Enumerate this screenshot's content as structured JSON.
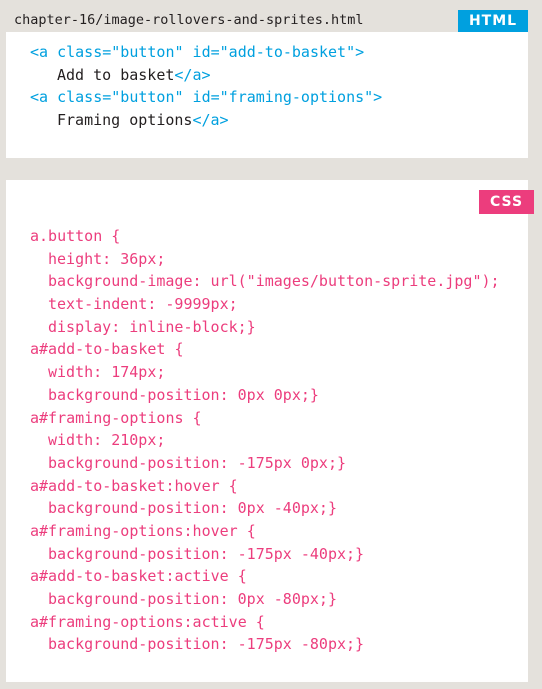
{
  "html_panel": {
    "filename": "chapter-16/image-rollovers-and-sprites.html",
    "tag": "HTML",
    "lines": [
      {
        "tag": "<a class=\"button\" id=\"add-to-basket\">"
      },
      {
        "text": "Add to basket",
        "close": "</a>"
      },
      {
        "tag": "<a class=\"button\" id=\"framing-options\">"
      },
      {
        "text": "Framing options",
        "close": "</a>"
      }
    ]
  },
  "css_panel": {
    "tag": "CSS",
    "lines": [
      "a.button {",
      "height: 36px;",
      "background-image: url(\"images/button-sprite.jpg\");",
      "text-indent: -9999px;",
      "display: inline-block;}",
      "a#add-to-basket {",
      "width: 174px;",
      "background-position: 0px 0px;}",
      "a#framing-options {",
      "width: 210px;",
      "background-position: -175px 0px;}",
      "a#add-to-basket:hover {",
      "background-position: 0px -40px;}",
      "a#framing-options:hover {",
      "background-position: -175px -40px;}",
      "a#add-to-basket:active {",
      "background-position: 0px -80px;}",
      "a#framing-options:active {",
      "background-position: -175px -80px;}"
    ]
  },
  "colors": {
    "html_accent": "#00a0df",
    "css_accent": "#ec3d7d",
    "background": "#e4e1dc"
  }
}
